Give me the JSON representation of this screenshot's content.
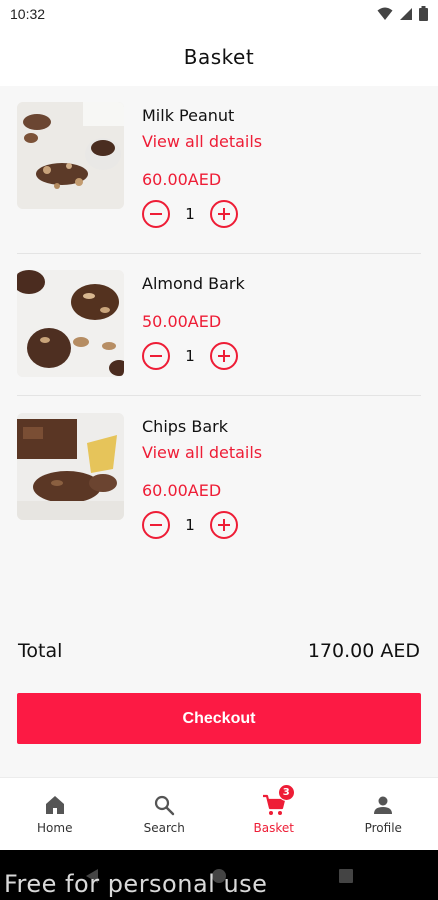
{
  "status_bar": {
    "time": "10:32"
  },
  "app_bar": {
    "title": "Basket"
  },
  "items": [
    {
      "name": "Milk Peanut",
      "details_link": "View all details",
      "price": "60.00AED",
      "quantity": "1"
    },
    {
      "name": "Almond Bark",
      "details_link": "",
      "price": "50.00AED",
      "quantity": "1"
    },
    {
      "name": "Chips Bark",
      "details_link": "View all details",
      "price": "60.00AED",
      "quantity": "1"
    }
  ],
  "summary": {
    "total_label": "Total",
    "total_value": "170.00 AED"
  },
  "checkout": {
    "label": "Checkout"
  },
  "bottom_nav": {
    "items": [
      {
        "label": "Home",
        "icon": "home-icon"
      },
      {
        "label": "Search",
        "icon": "search-icon"
      },
      {
        "label": "Basket",
        "icon": "cart-icon",
        "badge": "3",
        "active": true
      },
      {
        "label": "Profile",
        "icon": "person-icon"
      }
    ]
  },
  "watermark": "Free for personal use",
  "colors": {
    "accent": "#ee1d36",
    "button": "#fc1a44",
    "background": "#f7f7f7"
  }
}
